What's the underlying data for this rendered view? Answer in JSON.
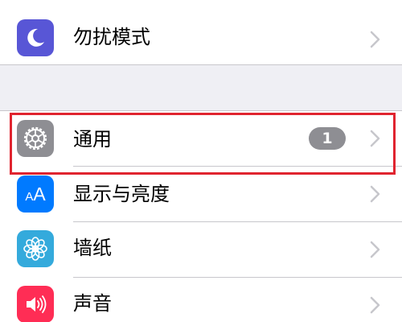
{
  "settings": {
    "rows": [
      {
        "label": "勿扰模式",
        "icon": "moon-icon",
        "icon_color": "#5856d6"
      },
      {
        "label": "通用",
        "icon": "gear-icon",
        "icon_color": "#8e8e93",
        "badge": "1"
      },
      {
        "label": "显示与亮度",
        "icon": "text-size-icon",
        "icon_glyph": "AA",
        "icon_color": "#007aff"
      },
      {
        "label": "墙纸",
        "icon": "flower-icon",
        "icon_color": "#34aadc"
      },
      {
        "label": "声音",
        "icon": "speaker-icon",
        "icon_color": "#ff2d55"
      }
    ]
  },
  "highlight": {
    "target": "通用",
    "color": "#e0242f"
  }
}
